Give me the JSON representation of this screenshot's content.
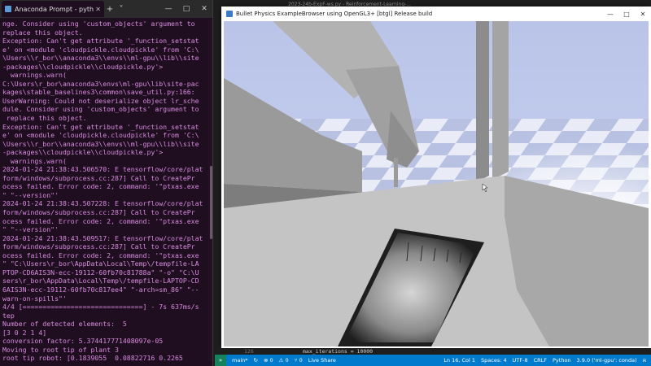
{
  "terminal_window": {
    "tab_title": "Anaconda Prompt - python r",
    "tab_close": "✕",
    "new_tab": "+",
    "dropdown": "˅",
    "minimize": "—",
    "maximize": "□",
    "close": "✕",
    "lines": [
      "nge. Consider using 'custom_objects' argument to",
      "replace this object.",
      "Exception: Can't get attribute '_function_setstat",
      "e' on <module 'cloudpickle.cloudpickle' from 'C:\\",
      "\\Users\\\\r_bor\\\\anaconda3\\\\envs\\\\ml-gpu\\\\lib\\\\site",
      "-packages\\\\cloudpickle\\\\cloudpickle.py'>",
      "  warnings.warn(",
      "C:\\Users\\r_bor\\anaconda3\\envs\\ml-gpu\\lib\\site-pac",
      "kages\\stable_baselines3\\common\\save_util.py:166:",
      "UserWarning: Could not deserialize object lr_sche",
      "dule. Consider using 'custom_objects' argument to",
      " replace this object.",
      "Exception: Can't get attribute '_function_setstat",
      "e' on <module 'cloudpickle.cloudpickle' from 'C:\\",
      "\\Users\\\\r_bor\\\\anaconda3\\\\envs\\\\ml-gpu\\\\lib\\\\site",
      "-packages\\\\cloudpickle\\\\cloudpickle.py'>",
      "  warnings.warn(",
      "2024-01-24 21:38:43.506570: E tensorflow/core/plat",
      "form/windows/subprocess.cc:287] Call to CreatePr",
      "ocess failed. Error code: 2, command: '\"ptxas.exe",
      "\" \"--version\"'",
      "2024-01-24 21:38:43.507228: E tensorflow/core/plat",
      "form/windows/subprocess.cc:287] Call to CreatePr",
      "ocess failed. Error code: 2, command: '\"ptxas.exe",
      "\" \"--version\"'",
      "2024-01-24 21:38:43.509517: E tensorflow/core/plat",
      "form/windows/subprocess.cc:287] Call to CreatePr",
      "ocess failed. Error code: 2, command: '\"ptxas.exe",
      "\" \"C:\\Users\\r_bor\\AppData\\Local\\Temp\\/tempfile-LA",
      "PTOP-CD6AIS3N-ecc-19112-60fb70c81788a\" \"-o\" \"C:\\U",
      "sers\\r_bor\\AppData\\Local\\Temp\\/tempfile-LAPTOP-CD",
      "6AIS3N-ecc-19112-60fb70c817ee4\" \"-arch=sm_86\" \"--",
      "warn-on-spills\"'",
      "4/4 [==============================] - 7s 637ms/s",
      "tep",
      "Number of detected elements:  5",
      "[3 0 2 1 4]",
      "conversion factor: 5.374417771408097e-05",
      "Moving to root tip of plant 3",
      "root tip robot: [0.1839055  0.08822716 0.2265"
    ]
  },
  "vscode_title_peek": "2023-24b-ExpF-ws.py - Reinforcement-Learning-...",
  "simulator_window": {
    "title": "Bullet Physics ExampleBrowser using OpenGL3+ [btgl] Release build",
    "minimize": "—",
    "maximize": "□",
    "close": "✕"
  },
  "editor_peek": {
    "line_number": "126",
    "code": "max_iterations = 10000"
  },
  "statusbar": {
    "remote_icon": "»",
    "branch": "main*",
    "sync": "↻",
    "errors": "⊗ 0",
    "warnings": "⚠ 0",
    "ports": "⑂ 0",
    "live_share": "Live Share",
    "position": "Ln 16, Col 1",
    "spaces": "Spaces: 4",
    "encoding": "UTF-8",
    "eol": "CRLF",
    "language": "Python",
    "interpreter": "3.9.0 ('ml-gpu': conda)",
    "notifications": "⍾"
  }
}
